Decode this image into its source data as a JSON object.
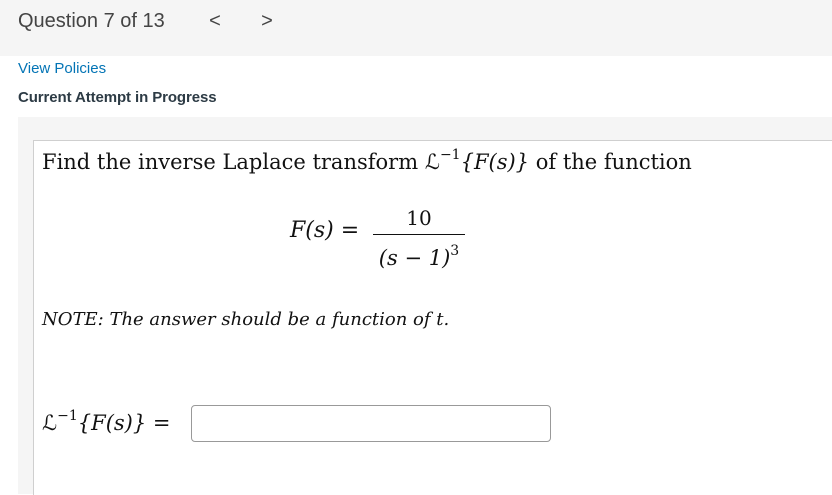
{
  "header": {
    "question_counter": "Question 7 of 13",
    "prev_glyph": "<",
    "next_glyph": ">"
  },
  "links": {
    "view_policies": "View Policies"
  },
  "status": {
    "attempt": "Current Attempt in Progress"
  },
  "question": {
    "prompt_text": "Find the inverse Laplace transform",
    "prompt_suffix": "of the function",
    "operator_script_L": "ℒ",
    "operator_exponent": "−1",
    "operator_arg": "{F(s)}",
    "equation_lhs": "F(s) =",
    "numerator": "10",
    "denominator": "(s − 1)",
    "denominator_exponent": "3",
    "note_text": "NOTE: The answer should be a function of t.",
    "answer_label_rhs": "{F(s)} ="
  },
  "answer_input": {
    "value": "",
    "placeholder": ""
  },
  "colors": {
    "link": "#0374b5",
    "header_bg": "#f5f5f5",
    "text": "#2d3b45"
  }
}
